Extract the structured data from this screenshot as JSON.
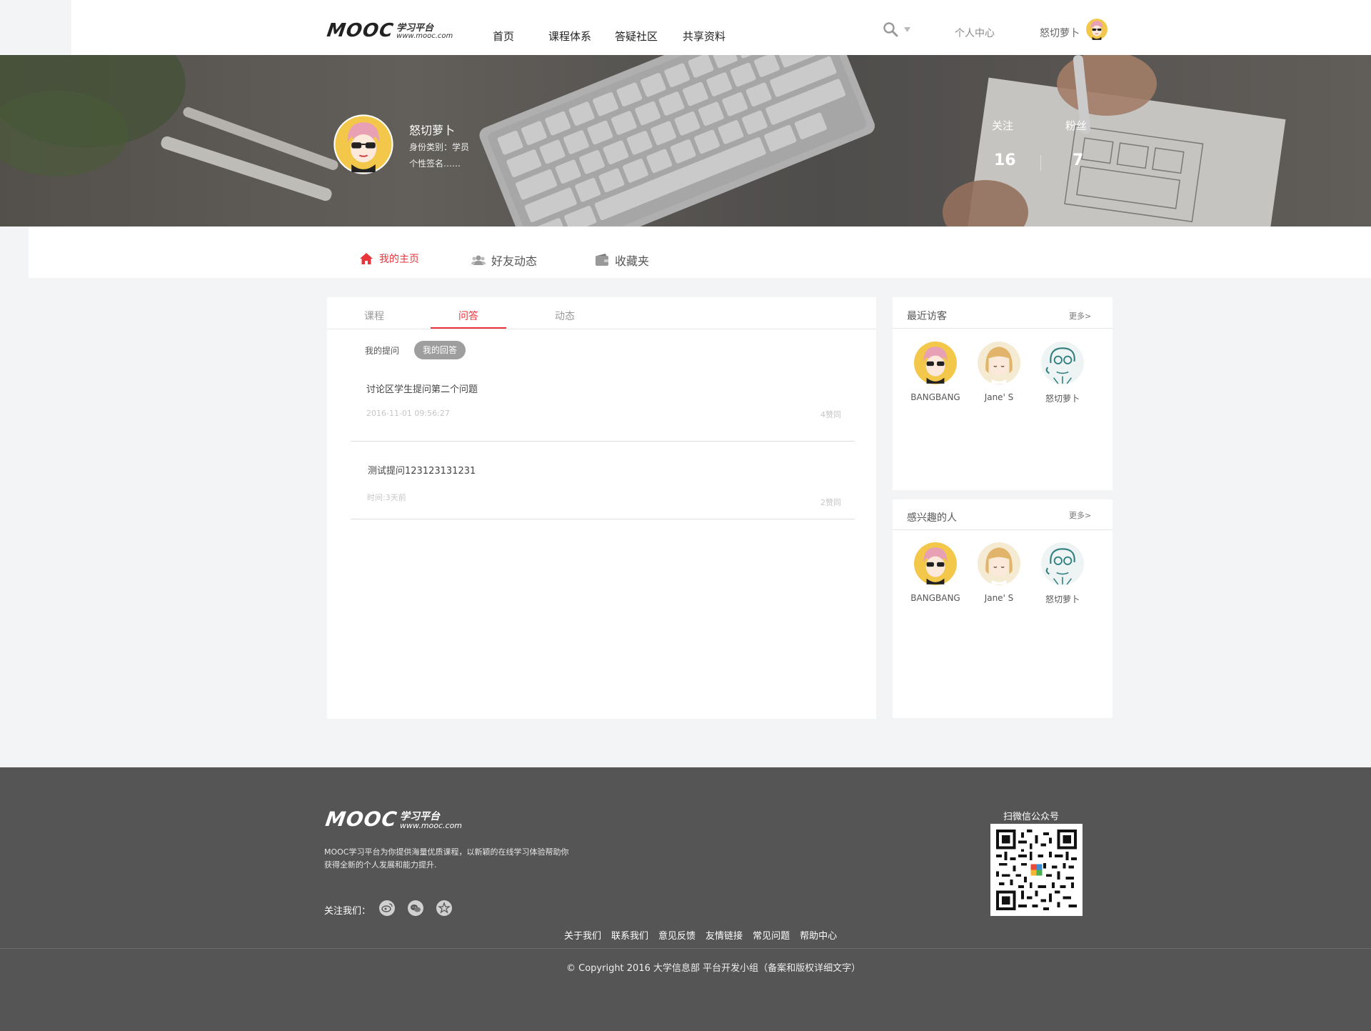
{
  "header": {
    "logo_mark": "MOOC",
    "logo_cn": "学习平台",
    "logo_url": "www.mooc.com",
    "nav": [
      "首页",
      "课程体系",
      "答疑社区",
      "共享资料"
    ],
    "user_center": "个人中心",
    "username": "怒切萝卜"
  },
  "profile": {
    "name": "怒切萝卜",
    "identity": "身份类别：学员",
    "signature": "个性签名……",
    "follow_label": "关注",
    "follow_count": "16",
    "fans_label": "粉丝",
    "fans_count": "7"
  },
  "tabs": [
    "我的主页",
    "好友动态",
    "收藏夹"
  ],
  "main": {
    "subtabs": [
      "课程",
      "问答",
      "动态"
    ],
    "active_subtab": "问答",
    "filters": [
      "我的提问",
      "我的回答"
    ],
    "active_filter": "我的回答",
    "items": [
      {
        "title": "讨论区学生提问第二个问题",
        "time": "2016-11-01 09:56:27",
        "likes": "4赞同"
      },
      {
        "title": "测试提问123123131231",
        "time": "时间:3天前",
        "likes": "2赞同"
      }
    ]
  },
  "sidebar": {
    "visitors_title": "最近访客",
    "interested_title": "感兴趣的人",
    "more": "更多>",
    "people": [
      "BANGBANG",
      "Jane' S",
      "怒切萝卜"
    ]
  },
  "footer": {
    "logo_mark": "MOOC",
    "logo_cn": "学习平台",
    "logo_url": "www.mooc.com",
    "desc_line1": "MOOC学习平台为你提供海量优质课程，以新颖的在线学习体验帮助你",
    "desc_line2": "获得全新的个人发展和能力提升.",
    "follow_us": "关注我们：",
    "qr_title": "扫微信公众号",
    "links": [
      "关于我们",
      "联系我们",
      "意见反馈",
      "友情链接",
      "常见问题",
      "帮助中心"
    ],
    "copyright": "© Copyright 2016 大学信息部 平台开发小组（备案和版权详细文字）"
  },
  "colors": {
    "accent": "#e8343a",
    "footer_bg": "#555555",
    "page_bg": "#f3f4f6"
  }
}
